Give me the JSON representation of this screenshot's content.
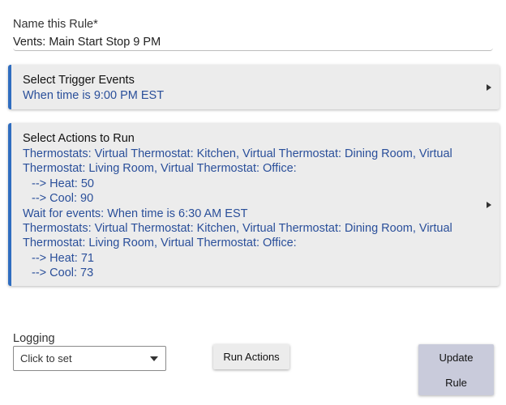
{
  "name_rule": {
    "label": "Name this Rule*",
    "value": "Vents: Main Start Stop 9 PM"
  },
  "trigger": {
    "title": "Select Trigger Events",
    "summary": "When time is 9:00 PM EST",
    "expand_icon": "triangle-right-icon"
  },
  "actions": {
    "title": "Select Actions to Run",
    "lines": [
      "Thermostats: Virtual Thermostat: Kitchen, Virtual Thermostat: Dining Room, Virtual",
      "Thermostat: Living Room, Virtual Thermostat: Office:",
      "--> Heat: 50",
      "--> Cool: 90",
      "Wait for events: When time is 6:30 AM EST",
      "Thermostats: Virtual Thermostat: Kitchen, Virtual Thermostat: Dining Room, Virtual",
      "Thermostat: Living Room, Virtual Thermostat: Office:",
      "--> Heat: 71",
      "--> Cool: 73"
    ],
    "expand_icon": "triangle-right-icon"
  },
  "logging": {
    "label": "Logging",
    "selected": "Click to set"
  },
  "buttons": {
    "run_actions": "Run Actions",
    "update_line1": "Update",
    "update_line2": "Rule"
  },
  "colors": {
    "accent": "#2f6dc0",
    "link_text": "#2a4f9a",
    "panel_bg": "#ececec",
    "update_bg": "#c9cbdb"
  }
}
